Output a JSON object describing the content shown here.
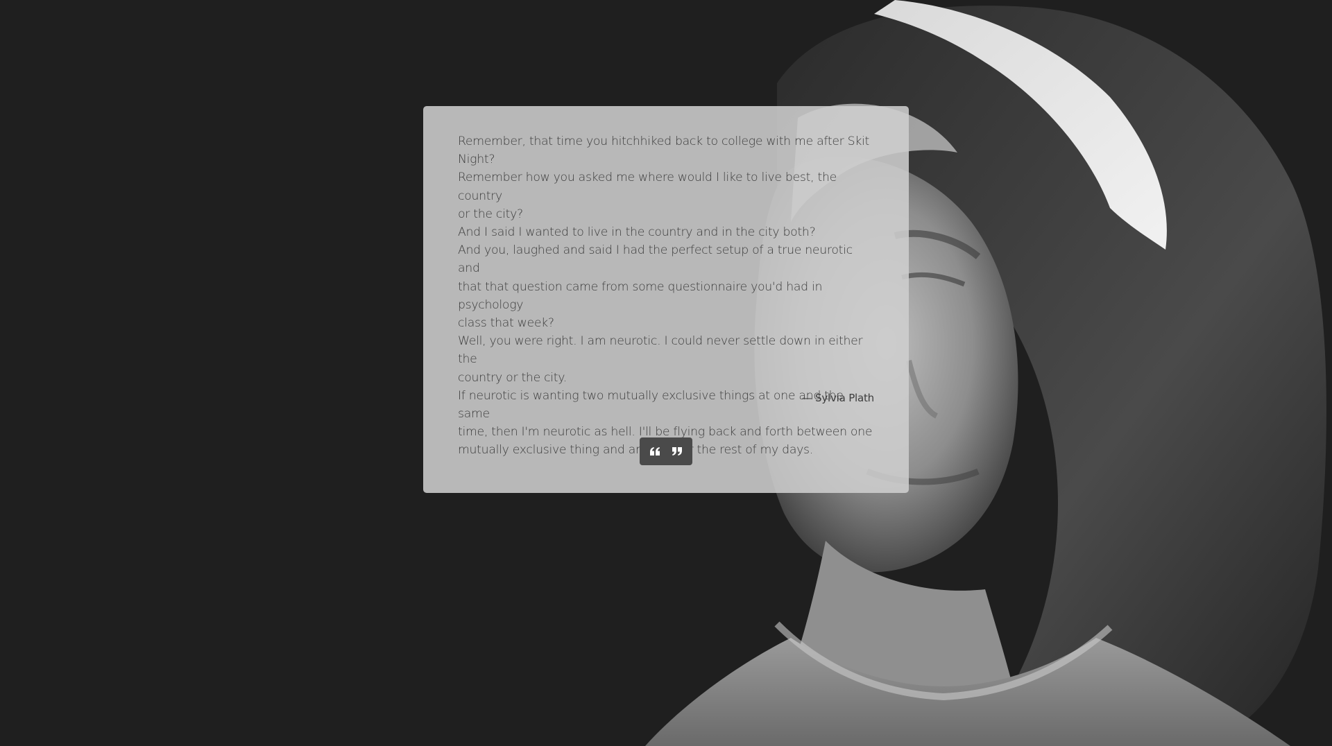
{
  "quote": {
    "lines": [
      "Remember, that time you hitchhiked back to college with me after Skit",
      "Night?",
      "Remember how you asked me where would I like to live best, the country",
      "or the city?",
      "And I said I wanted to live in the country and in the city both?",
      "And you, laughed and said I had the perfect setup of a true neurotic and",
      "that that question came from some questionnaire you'd had in psychology",
      "class that week?",
      "Well, you were right. I am neurotic. I could never settle down in either the",
      "country or the city.",
      "If neurotic is wanting two mutually exclusive things at one and the same",
      "time, then I'm neurotic as hell. I'll be flying back and forth between one",
      "mutually exclusive thing and another for the rest of my days."
    ],
    "author": "— Sylvia Plath"
  },
  "controls": {
    "left_icon": "quote-left-icon",
    "right_icon": "quote-right-icon"
  },
  "colors": {
    "page_background": "#1f1f1f",
    "card_background": "#cecece",
    "text": "#3c3c3c",
    "button_group": "#4a4a4a",
    "button_icon": "#ffffff"
  }
}
